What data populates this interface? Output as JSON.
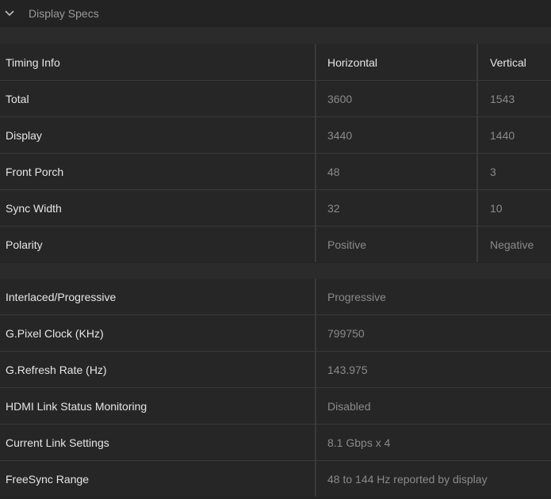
{
  "header": {
    "title": "Display Specs"
  },
  "timing": {
    "columns": [
      "Timing Info",
      "Horizontal",
      "Vertical"
    ],
    "rows": [
      {
        "label": "Total",
        "h": "3600",
        "v": "1543"
      },
      {
        "label": "Display",
        "h": "3440",
        "v": "1440"
      },
      {
        "label": "Front Porch",
        "h": "48",
        "v": "3"
      },
      {
        "label": "Sync Width",
        "h": "32",
        "v": "10"
      },
      {
        "label": "Polarity",
        "h": "Positive",
        "v": "Negative"
      }
    ]
  },
  "specs": {
    "rows": [
      {
        "label": "Interlaced/Progressive",
        "value": "Progressive"
      },
      {
        "label": "G.Pixel Clock (KHz)",
        "value": "799750"
      },
      {
        "label": "G.Refresh Rate (Hz)",
        "value": "143.975"
      },
      {
        "label": "HDMI Link Status Monitoring",
        "value": "Disabled"
      },
      {
        "label": "Current Link Settings",
        "value": "8.1 Gbps x 4"
      },
      {
        "label": "FreeSync Range",
        "value": "48 to 144 Hz reported by display"
      }
    ]
  }
}
